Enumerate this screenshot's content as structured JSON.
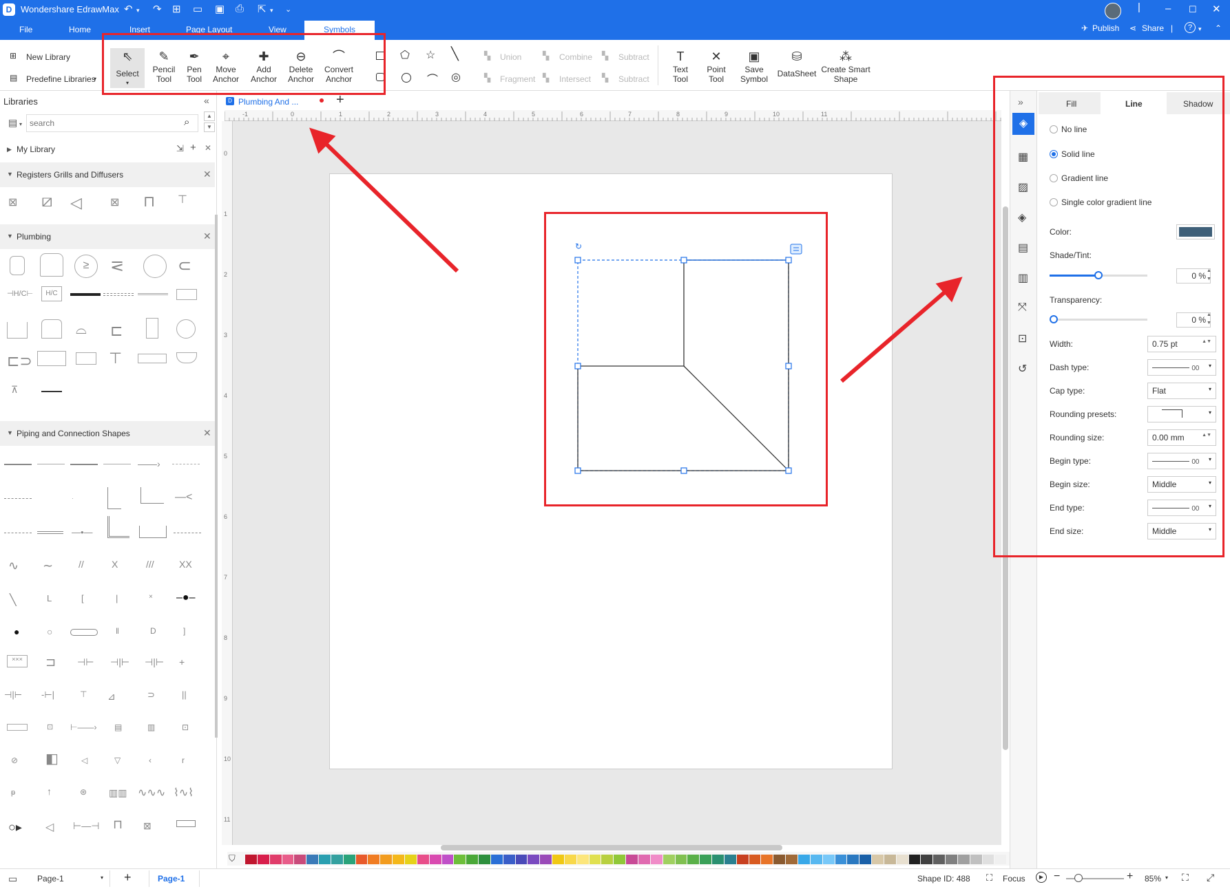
{
  "titlebar": {
    "app_name": "Wondershare EdrawMax",
    "publish": "Publish",
    "share": "Share",
    "help": "?"
  },
  "menu": {
    "file": "File",
    "home": "Home",
    "insert": "Insert",
    "page_layout": "Page Layout",
    "view": "View",
    "symbols": "Symbols"
  },
  "ribbon": {
    "new_library": "New Library",
    "predefine_libraries": "Predefine Libraries",
    "select": "Select",
    "pencil": [
      "Pencil",
      "Tool"
    ],
    "pen": [
      "Pen",
      "Tool"
    ],
    "move_anchor": [
      "Move",
      "Anchor"
    ],
    "add_anchor": [
      "Add",
      "Anchor"
    ],
    "delete_anchor": [
      "Delete",
      "Anchor"
    ],
    "convert_anchor": [
      "Convert",
      "Anchor"
    ],
    "union": "Union",
    "combine": "Combine",
    "subtract": "Subtract",
    "fragment": "Fragment",
    "intersect": "Intersect",
    "subtract2": "Subtract",
    "text_tool": [
      "Text",
      "Tool"
    ],
    "point_tool": [
      "Point",
      "Tool"
    ],
    "save_symbol": [
      "Save",
      "Symbol"
    ],
    "datasheet": "DataSheet",
    "create_smart": [
      "Create Smart",
      "Shape"
    ]
  },
  "libraries": {
    "title": "Libraries",
    "search_placeholder": "search",
    "my_library": "My Library",
    "sections": [
      "Registers Grills and Diffusers",
      "Plumbing",
      "Piping and Connection Shapes"
    ]
  },
  "doc_tab": {
    "name": "Plumbing And ..."
  },
  "ruler": {
    "h": [
      "-1",
      "0",
      "1",
      "2",
      "3",
      "4",
      "5",
      "6",
      "7",
      "8",
      "9",
      "10",
      "11"
    ],
    "v": [
      "0",
      "1",
      "2",
      "3",
      "4",
      "5",
      "6",
      "7",
      "8",
      "9",
      "10",
      "11"
    ]
  },
  "right_panel": {
    "tabs": [
      "Fill",
      "Line",
      "Shadow"
    ],
    "options": [
      "No line",
      "Solid line",
      "Gradient line",
      "Single color gradient line"
    ],
    "color_label": "Color:",
    "color_value": "#3f6079",
    "shade_label": "Shade/Tint:",
    "shade_value": "0 %",
    "shade_level": 0.5,
    "transparency_label": "Transparency:",
    "transparency_value": "0 %",
    "width_label": "Width:",
    "width_value": "0.75 pt",
    "dash_label": "Dash type:",
    "dash_value": "00",
    "cap_label": "Cap type:",
    "cap_value": "Flat",
    "rounding_presets_label": "Rounding presets:",
    "rounding_size_label": "Rounding size:",
    "rounding_size_value": "0.00 mm",
    "begin_type_label": "Begin type:",
    "begin_type_value": "00",
    "begin_size_label": "Begin size:",
    "begin_size_value": "Middle",
    "end_type_label": "End type:",
    "end_type_value": "00",
    "end_size_label": "End size:",
    "end_size_value": "Middle"
  },
  "statusbar": {
    "page_select": "Page-1",
    "page_tab": "Page-1",
    "shape_id": "Shape ID: 488",
    "focus": "Focus",
    "zoom": "85%"
  },
  "colors": {
    "accent": "#1f70e8",
    "highlight_red": "#e8242a"
  }
}
